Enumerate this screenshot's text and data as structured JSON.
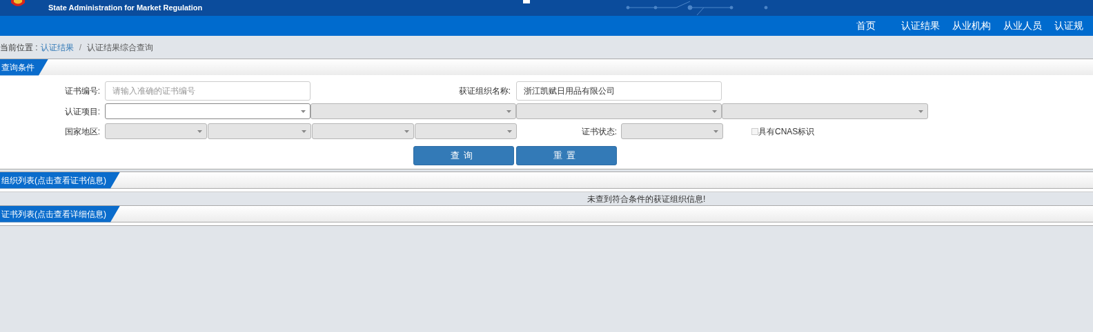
{
  "header": {
    "title": "State Administration for Market Regulation"
  },
  "nav": {
    "items": [
      {
        "label": "首页",
        "selected": false
      },
      {
        "label": "认证结果",
        "selected": false
      },
      {
        "label": "从业机构",
        "selected": false
      },
      {
        "label": "从业人员",
        "selected": false
      },
      {
        "label": "认证规",
        "selected": false
      }
    ]
  },
  "breadcrumb": {
    "label": "当前位置 :",
    "link": "认证结果",
    "separator": "/",
    "current": "认证结果综合查询"
  },
  "query": {
    "title": "查询条件",
    "cert_no": {
      "label": "证书编号:",
      "placeholder": "请输入准确的证书编号"
    },
    "org_name": {
      "label": "获证组织名称:",
      "value": "浙江凯赋日用品有限公司"
    },
    "cert_project": {
      "label": "认证项目:",
      "selects": [
        {
          "disabled": false
        },
        {
          "disabled": true
        },
        {
          "disabled": true
        },
        {
          "disabled": true
        }
      ]
    },
    "region": {
      "label": "国家地区:",
      "selects": [
        {
          "disabled": true
        },
        {
          "disabled": true
        },
        {
          "disabled": true
        },
        {
          "disabled": true
        }
      ]
    },
    "status": {
      "label": "证书状态:",
      "disabled": true
    },
    "cnas": {
      "label": "具有CNAS标识",
      "checked": false
    },
    "buttons": [
      "查询",
      "重置"
    ]
  },
  "org_list": {
    "title": "组织列表(点击查看证书信息)",
    "message": "未查到符合条件的获证组织信息!"
  },
  "cert_list": {
    "title": "证书列表(点击查看详细信息)"
  }
}
